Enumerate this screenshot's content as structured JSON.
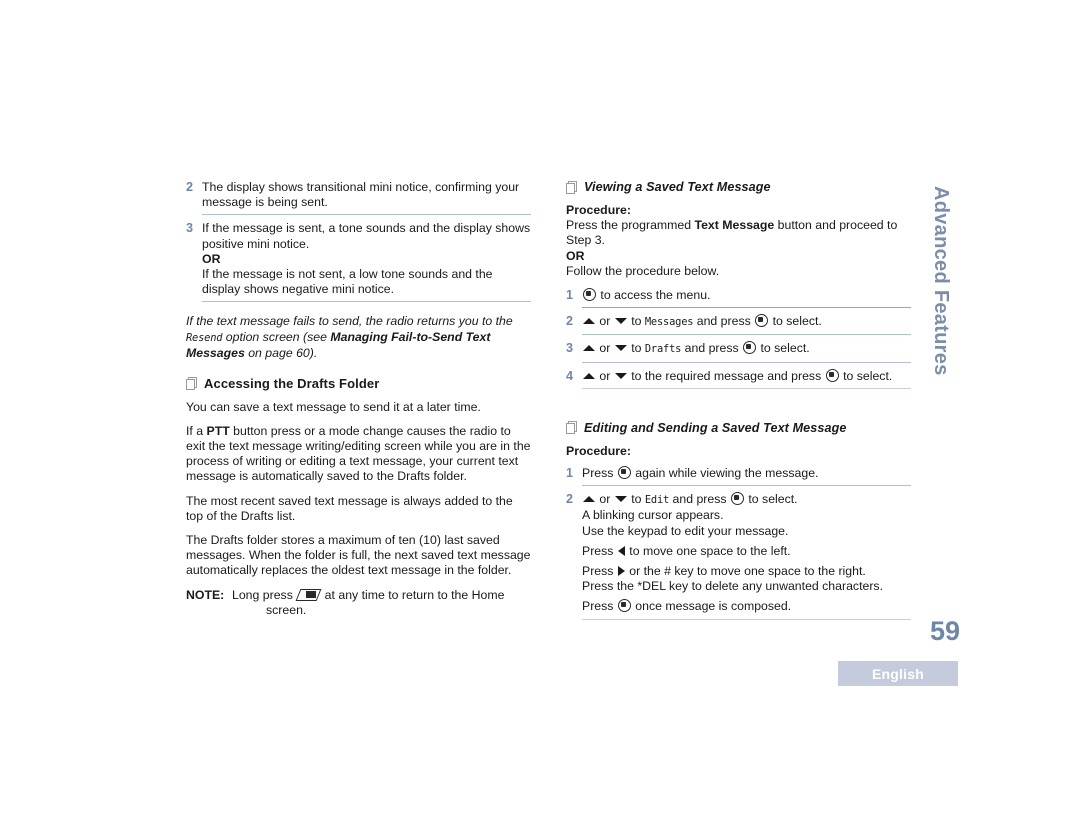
{
  "document": {
    "page_number": "59",
    "language_tag": "English",
    "side_tab": "Advanced Features",
    "accent_color": "#6e86a8",
    "lang_box_color": "#c3cbdc",
    "rule_color": "#9aafc9"
  },
  "left_column": {
    "steps_top": [
      {
        "number": "2",
        "lines": [
          "The display shows transitional mini notice, confirming your",
          "message is being sent."
        ]
      },
      {
        "number": "3",
        "lines": [
          "If the message is sent, a tone sounds and the display shows",
          "positive mini notice."
        ],
        "or_label": "OR",
        "lines_after": [
          "If the message is not sent, a low tone sounds and the",
          "display shows negative mini notice."
        ]
      }
    ],
    "italic_note": {
      "part1": "If the text message fails to send, the radio returns you to the ",
      "mono": "Resend",
      "part2": " option screen (see ",
      "bold": "Managing Fail-to-Send Text Messages",
      "part3": " on page 60)."
    },
    "section_heading": "Accessing the Drafts Folder",
    "paragraphs": [
      {
        "lines": [
          "You can save a text message to send it at a later time."
        ]
      },
      {
        "pre": "If a ",
        "bold": "PTT",
        "post": " button press or a mode change causes the radio to exit the text message writing/editing screen while you are in the process of writing or editing a text message, your current text message is automatically saved to the Drafts folder."
      },
      {
        "lines": [
          "The most recent saved text message is always added to the top of the Drafts list."
        ]
      },
      {
        "lines": [
          "The Drafts folder stores a maximum of ten (10) last saved messages. When the folder is full, the next saved text message automatically replaces the oldest text message in the folder."
        ]
      }
    ],
    "note": {
      "label": "NOTE:",
      "text_before_icon": "Long press ",
      "icon": "home-key-icon",
      "text_after_icon": " at any time to return to the Home",
      "second_line": "screen."
    }
  },
  "right_column": {
    "section_1": {
      "heading": "Viewing a Saved Text Message",
      "procedure_label": "Procedure:",
      "intro_pre": "Press the programmed ",
      "intro_bold": "Text Message",
      "intro_post": " button and proceed to Step 3.",
      "or_label": "OR",
      "follow": "Follow the procedure below.",
      "steps": [
        {
          "number": "1",
          "text_after_menu": " to access the menu."
        },
        {
          "number": "2",
          "mid": " or ",
          "to": " to ",
          "mono": "Messages",
          "tail": " and press ",
          "end": " to select."
        },
        {
          "number": "3",
          "mid": " or ",
          "to": " to ",
          "mono": "Drafts",
          "tail": " and press ",
          "end": " to select."
        },
        {
          "number": "4",
          "mid": " or ",
          "to": " to the required message and press ",
          "mono": "",
          "tail": "",
          "end": " to select."
        }
      ]
    },
    "section_2": {
      "heading": "Editing and Sending a Saved Text Message",
      "procedure_label": "Procedure:",
      "step1": {
        "number": "1",
        "pre": "Press ",
        "post": " again while viewing the message."
      },
      "step2": {
        "number": "2",
        "mid": " or ",
        "to": " to ",
        "mono": "Edit",
        "tail": " and press ",
        "end": " to select.",
        "sub_lines": [
          "A blinking cursor appears.",
          "Use the keypad to edit your message."
        ],
        "press_left_pre": "Press ",
        "press_left_post": " to move one space to the left.",
        "press_right_pre": "Press ",
        "press_right_post": " or the # key to move one space to the right.",
        "press_del": "Press the *DEL key to delete any unwanted characters.",
        "press_menu_pre": "Press ",
        "press_menu_post": " once message is composed."
      }
    }
  }
}
